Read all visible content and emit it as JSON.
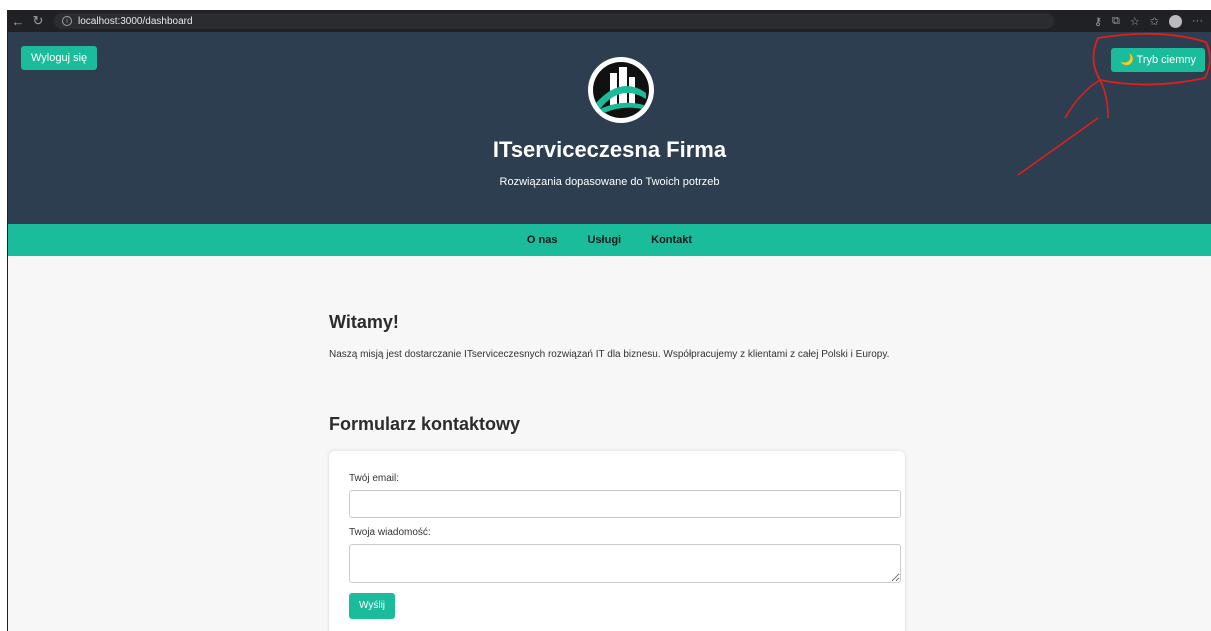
{
  "browser": {
    "url": "localhost:3000/dashboard",
    "back_icon": "back-arrow-icon",
    "reload_icon": "reload-icon"
  },
  "header": {
    "logout_label": "Wyloguj się",
    "darkmode_label": "🌙 Tryb ciemny",
    "brand": "ITserviceczesna Firma",
    "tagline": "Rozwiązania dopasowane do Twoich potrzeb"
  },
  "nav": {
    "items": [
      "O nas",
      "Usługi",
      "Kontakt"
    ]
  },
  "welcome": {
    "title": "Witamy!",
    "text": "Naszą misją jest dostarczanie ITserviceczesnych rozwiązań IT dla biznesu. Współpracujemy z klientami z całej Polski i Europy."
  },
  "contact": {
    "title": "Formularz kontaktowy",
    "email_label": "Twój email:",
    "message_label": "Twoja wiadomość:",
    "submit_label": "Wyślij"
  },
  "colors": {
    "header_bg": "#2c3e50",
    "accent": "#1abc9c",
    "annotation": "#e0201b"
  }
}
